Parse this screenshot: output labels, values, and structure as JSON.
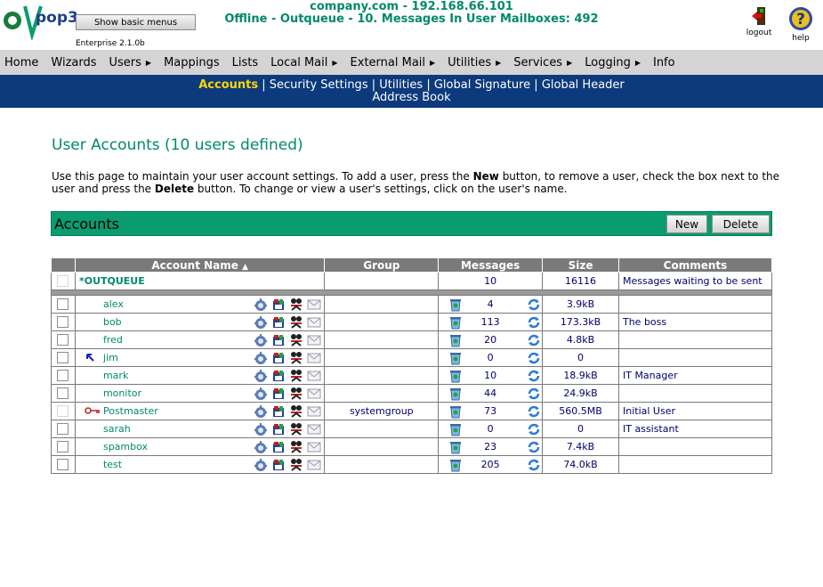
{
  "header": {
    "logo_text": "pop3",
    "basic_menus_button": "Show basic menus",
    "edition": "Enterprise 2.1.0b",
    "host": "company.com - 192.168.66.101",
    "status": "Offline - Outqueue - 10. Messages In User Mailboxes: 492",
    "logout_label": "logout",
    "help_label": "help"
  },
  "menu": [
    {
      "label": "Home",
      "arrow": false
    },
    {
      "label": "Wizards",
      "arrow": false
    },
    {
      "label": "Users",
      "arrow": true
    },
    {
      "label": "Mappings",
      "arrow": false
    },
    {
      "label": "Lists",
      "arrow": false
    },
    {
      "label": "Local Mail",
      "arrow": true
    },
    {
      "label": "External Mail",
      "arrow": true
    },
    {
      "label": "Utilities",
      "arrow": true
    },
    {
      "label": "Services",
      "arrow": true
    },
    {
      "label": "Logging",
      "arrow": true
    },
    {
      "label": "Info",
      "arrow": false
    }
  ],
  "subnav": {
    "accounts": "Accounts",
    "security": "Security Settings",
    "utilities": "Utilities",
    "signature": "Global Signature",
    "global_header": "Global Header",
    "address_book": "Address Book",
    "separator": " | "
  },
  "page": {
    "title": "User Accounts (10 users defined)",
    "intro_1": "Use this page to maintain your user account settings. To add a user, press the ",
    "intro_new": "New",
    "intro_2": " button, to remove a user, check the box next to the user and press the ",
    "intro_delete": "Delete",
    "intro_3": " button. To change or view a user's settings, click on the user's name."
  },
  "accounts_bar": {
    "heading": "Accounts",
    "new_button": "New",
    "delete_button": "Delete"
  },
  "table": {
    "columns": {
      "account_name": "Account Name",
      "group": "Group",
      "messages": "Messages",
      "size": "Size",
      "comments": "Comments"
    },
    "sort_indicator": "▲",
    "outqueue": {
      "name": "*OUTQUEUE",
      "messages": "10",
      "size": "16116",
      "comment": "Messages waiting to be sent"
    },
    "rows": [
      {
        "name": "alex",
        "group": "",
        "messages": "4",
        "size": "3.9kB",
        "comment": ""
      },
      {
        "name": "bob",
        "group": "",
        "messages": "113",
        "size": "173.3kB",
        "comment": "The boss"
      },
      {
        "name": "fred",
        "group": "",
        "messages": "20",
        "size": "4.8kB",
        "comment": ""
      },
      {
        "name": "jim",
        "group": "",
        "messages": "0",
        "size": "0",
        "comment": ""
      },
      {
        "name": "mark",
        "group": "",
        "messages": "10",
        "size": "18.9kB",
        "comment": "IT Manager"
      },
      {
        "name": "monitor",
        "group": "",
        "messages": "44",
        "size": "24.9kB",
        "comment": ""
      },
      {
        "name": "Postmaster",
        "group": "systemgroup",
        "messages": "73",
        "size": "560.5MB",
        "comment": "Initial User"
      },
      {
        "name": "sarah",
        "group": "",
        "messages": "0",
        "size": "0",
        "comment": "IT assistant"
      },
      {
        "name": "spambox",
        "group": "",
        "messages": "23",
        "size": "7.4kB",
        "comment": ""
      },
      {
        "name": "test",
        "group": "",
        "messages": "205",
        "size": "74.0kB",
        "comment": ""
      }
    ]
  },
  "colors": {
    "accent_green": "#00896b",
    "nav_blue": "#0c3a7c",
    "active_yellow": "#ffd700",
    "bar_green": "#0a9c6e"
  }
}
